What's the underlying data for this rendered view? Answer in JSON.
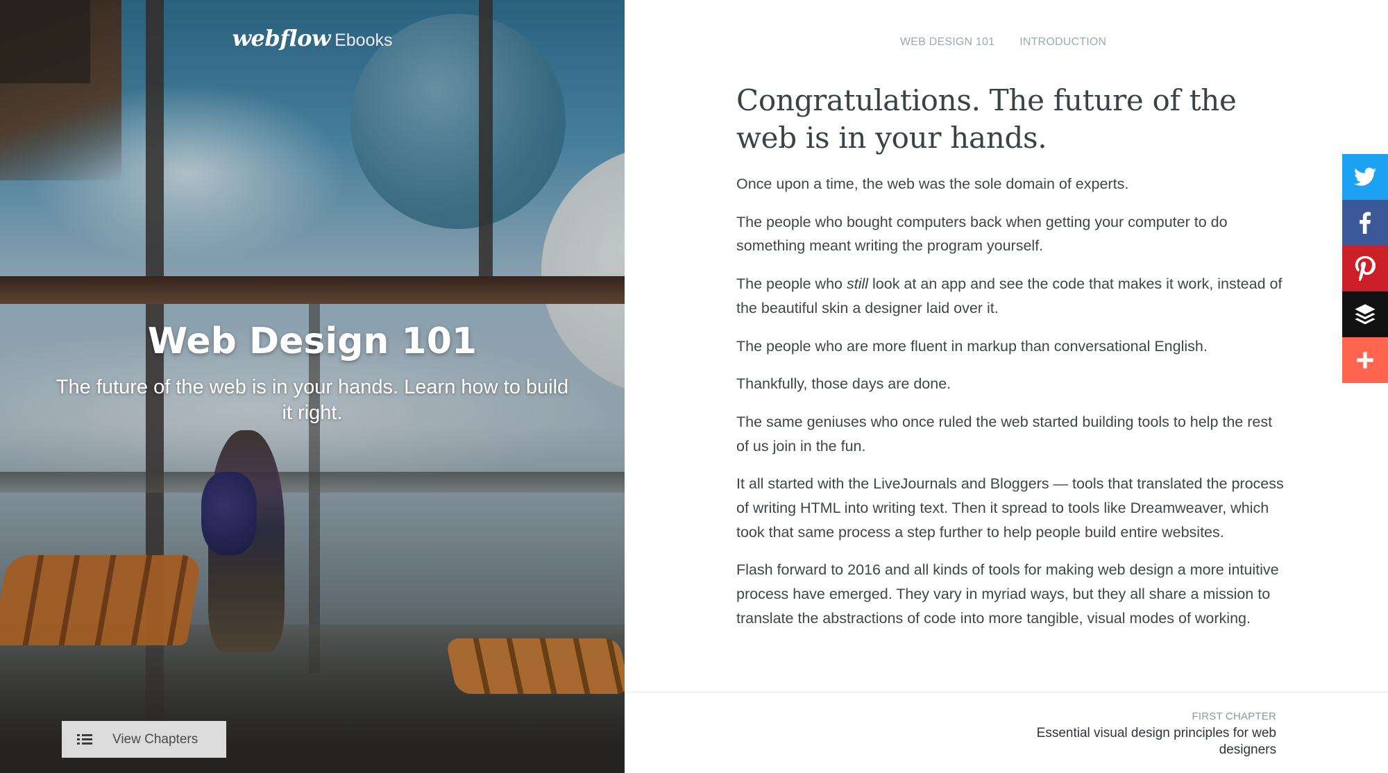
{
  "hero": {
    "brand_logo": "webflow",
    "brand_suffix": "Ebooks",
    "title": "Web Design 101",
    "subtitle": "The future of the web is in your hands. Learn how to build it right.",
    "view_chapters_label": "View Chapters"
  },
  "breadcrumb": {
    "items": [
      "WEB DESIGN 101",
      "INTRODUCTION"
    ]
  },
  "article": {
    "heading": "Congratulations. The future of the web is in your hands.",
    "paragraphs": [
      "Once upon a time, the web was the sole domain of experts.",
      "The people who bought computers back when getting your computer to do something meant writing the program yourself.",
      {
        "before": "The people who ",
        "emphasis": "still",
        "after": " look at an app and see the code that makes it work, instead of the beautiful skin a designer laid over it."
      },
      "The people who are more fluent in markup than conversational English.",
      "Thankfully, those days are done.",
      "The same geniuses who once ruled the web started building tools to help the rest of us join in the fun.",
      "It all started with the LiveJournals and Bloggers — tools that translated the process of writing HTML into writing text. Then it spread to tools like Dreamweaver, which took that same process a step further to help people build entire websites.",
      "Flash forward to 2016 and all kinds of tools for making web design a more intuitive process have emerged. They vary in myriad ways, but they all share a mission to translate the abstractions of code into more tangible, visual modes of working."
    ]
  },
  "next_chapter": {
    "kicker": "FIRST CHAPTER",
    "title": "Essential visual design principles for web designers"
  },
  "share_bar": {
    "buttons": [
      {
        "icon": "twitter-icon",
        "color": "#1da1f2"
      },
      {
        "icon": "facebook-icon",
        "color": "#3b5998"
      },
      {
        "icon": "pinterest-icon",
        "color": "#cb2027"
      },
      {
        "icon": "buffer-icon",
        "color": "#111111"
      },
      {
        "icon": "plus-icon",
        "color": "#ff6550"
      }
    ]
  },
  "colors": {
    "body_text": "#3f4549",
    "breadcrumb": "#9aa9b4",
    "heading": "#3a4147"
  }
}
